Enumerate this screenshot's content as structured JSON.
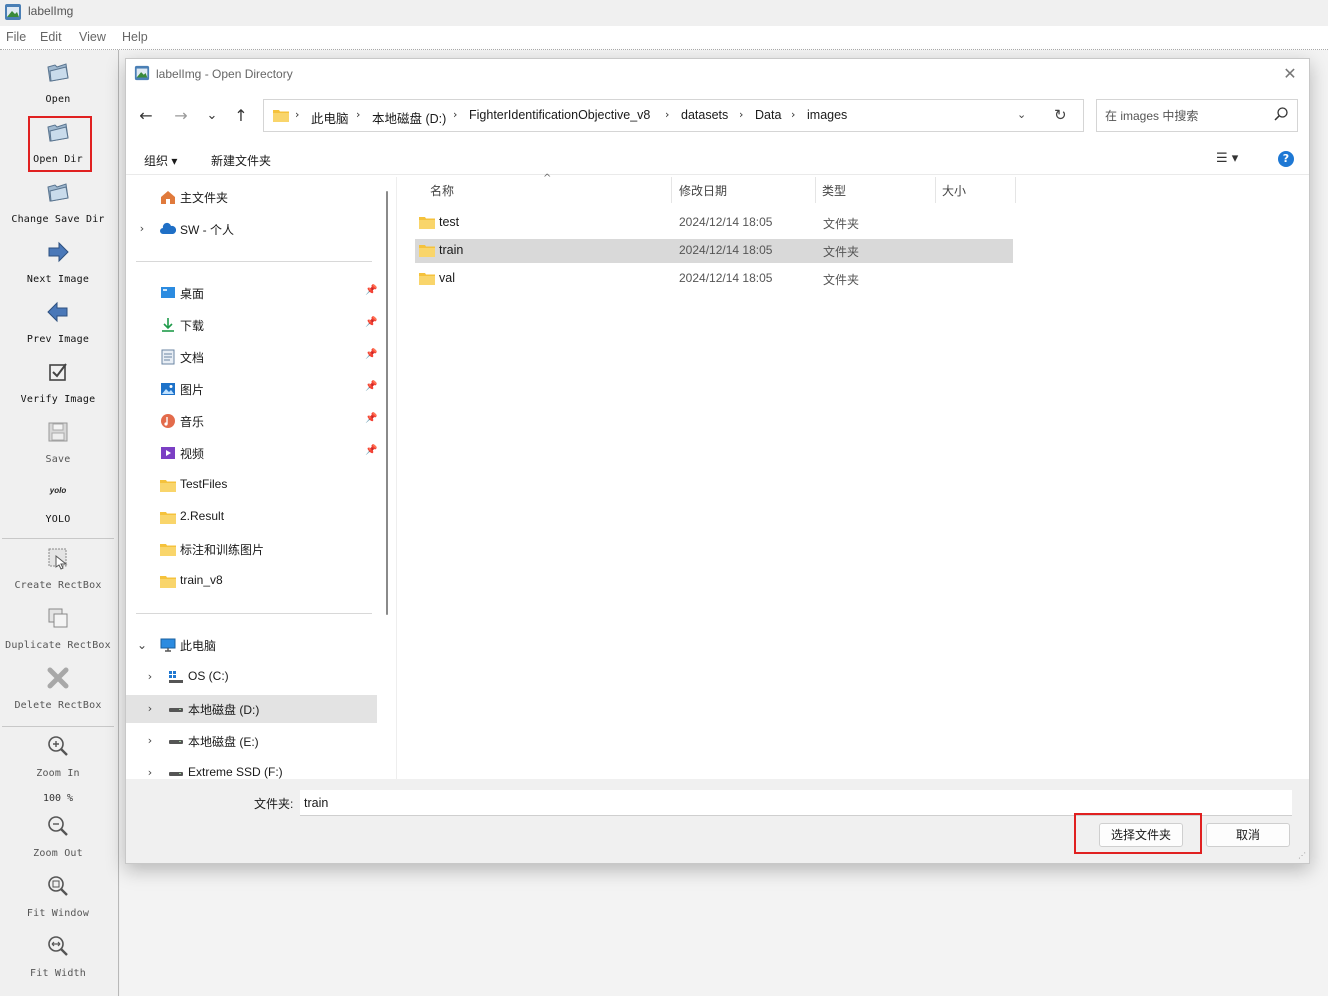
{
  "app": {
    "title": "labelImg",
    "menu": [
      "File",
      "Edit",
      "View",
      "Help"
    ]
  },
  "toolbar": {
    "open": "Open",
    "open_dir": "Open Dir",
    "change_save_dir": "Change Save Dir",
    "next_image": "Next Image",
    "prev_image": "Prev Image",
    "verify_image": "Verify Image",
    "save": "Save",
    "yolo_icon_text": "yolo",
    "yolo": "YOLO",
    "create_rectbox": "Create RectBox",
    "duplicate_rectbox": "Duplicate RectBox",
    "delete_rectbox": "Delete RectBox",
    "zoom_in": "Zoom In",
    "zoom_level": "100 %",
    "zoom_out": "Zoom Out",
    "fit_window": "Fit Window",
    "fit_width": "Fit Width"
  },
  "dialog": {
    "title": "labelImg - Open Directory",
    "close_glyph": "✕",
    "nav": {
      "back": "←",
      "forward": "→",
      "recent": "⌄",
      "up": "↑"
    },
    "breadcrumbs": [
      "此电脑",
      "本地磁盘 (D:)",
      "FighterIdentificationObjective_v8",
      "datasets",
      "Data",
      "images"
    ],
    "search_placeholder": "在 images 中搜索",
    "commands": {
      "organize": "组织 ▾",
      "new_folder": "新建文件夹",
      "view": "☰ ▾",
      "help": "?"
    },
    "nav_pane": {
      "quick": [
        {
          "label": "主文件夹",
          "icon": "home-icon"
        },
        {
          "label": "SW - 个人",
          "icon": "cloud-icon"
        }
      ],
      "pinned": [
        {
          "label": "桌面",
          "icon": "desktop-icon"
        },
        {
          "label": "下载",
          "icon": "download-icon"
        },
        {
          "label": "文档",
          "icon": "document-icon"
        },
        {
          "label": "图片",
          "icon": "pictures-icon"
        },
        {
          "label": "音乐",
          "icon": "music-icon"
        },
        {
          "label": "视频",
          "icon": "video-icon"
        },
        {
          "label": "TestFiles",
          "icon": "folder-icon"
        },
        {
          "label": "2.Result",
          "icon": "folder-icon"
        },
        {
          "label": "标注和训练图片",
          "icon": "folder-icon"
        },
        {
          "label": "train_v8",
          "icon": "folder-icon"
        }
      ],
      "this_pc": "此电脑",
      "drives": [
        {
          "label": "OS (C:)",
          "icon": "windows-drive-icon"
        },
        {
          "label": "本地磁盘 (D:)",
          "icon": "drive-icon",
          "selected": true
        },
        {
          "label": "本地磁盘 (E:)",
          "icon": "drive-icon"
        },
        {
          "label": "Extreme SSD (F:)",
          "icon": "drive-icon"
        }
      ]
    },
    "columns": [
      "名称",
      "修改日期",
      "类型",
      "大小"
    ],
    "files": [
      {
        "name": "test",
        "modified": "2024/12/14 18:05",
        "type": "文件夹",
        "size": ""
      },
      {
        "name": "train",
        "modified": "2024/12/14 18:05",
        "type": "文件夹",
        "size": "",
        "selected": true
      },
      {
        "name": "val",
        "modified": "2024/12/14 18:05",
        "type": "文件夹",
        "size": ""
      }
    ],
    "folder_label": "文件夹:",
    "folder_value": "train",
    "select_button": "选择文件夹",
    "cancel_button": "取消"
  },
  "colors": {
    "highlight": "#e02020",
    "folder": "#f5c23c",
    "accent": "#1e78d4",
    "selection": "#d9d9d9"
  }
}
